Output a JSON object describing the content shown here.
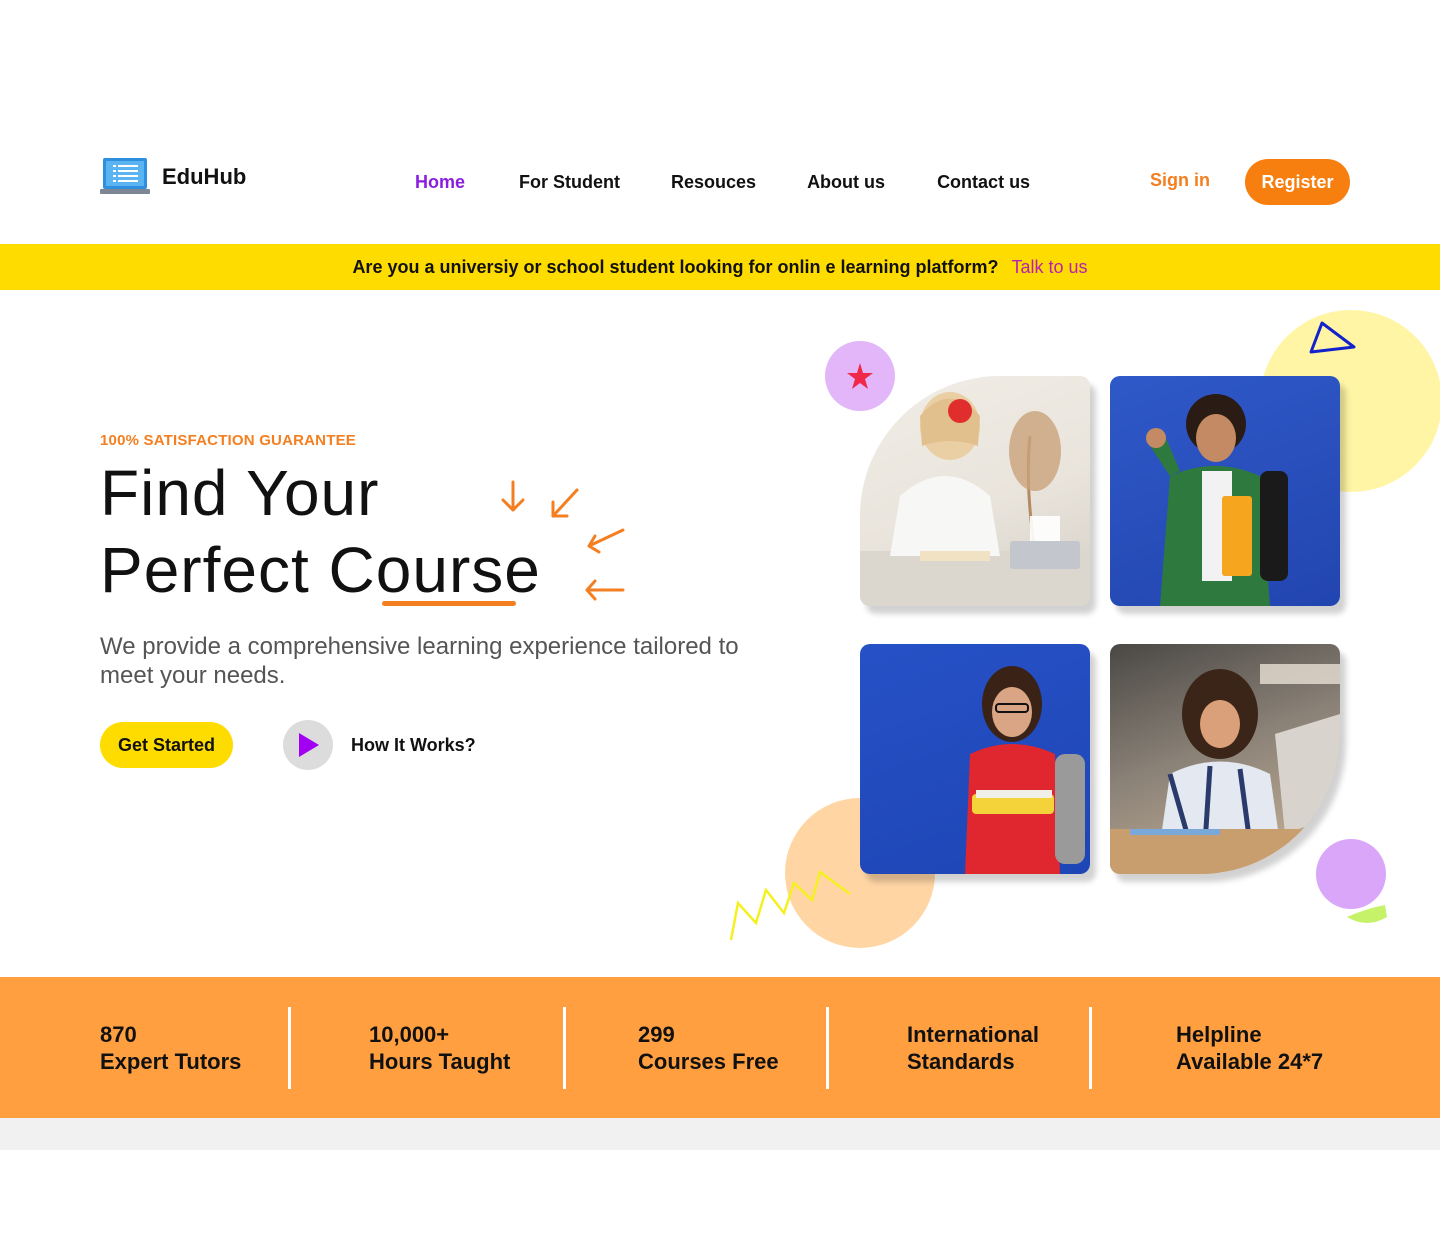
{
  "header": {
    "brand": "EduHub",
    "nav": [
      "Home",
      "For Student",
      "Resouces",
      "About us",
      "Contact us"
    ],
    "active_nav": "Home",
    "sign_in": "Sign in",
    "register": "Register"
  },
  "banner": {
    "question": "Are you a universiy or school student looking for onlin e learning platform?",
    "link": "Talk to us"
  },
  "hero": {
    "eyebrow": "100% SATISFACTION GUARANTEE",
    "headline_line1": "Find Your",
    "headline_line2": "Perfect Course",
    "description": "We provide a comprehensive learning experience tailored to meet your needs.",
    "cta": "Get Started",
    "how_it_works": "How It Works?"
  },
  "stats": [
    {
      "value": "870",
      "label": "Expert Tutors"
    },
    {
      "value": "10,000+",
      "label": "Hours Taught"
    },
    {
      "value": "299",
      "label": "Courses Free"
    },
    {
      "value": "International",
      "label": "Standards"
    },
    {
      "value": "Helpline",
      "label": "Available 24*7"
    }
  ],
  "colors": {
    "accent_orange": "#f77f0f",
    "banner_yellow": "#ffdc00",
    "active_purple": "#8a1ee0",
    "stats_band": "#ff9f40",
    "talk_link": "#b820b0"
  },
  "icons": {
    "logo": "laptop-icon",
    "play": "play-icon",
    "star": "star-icon"
  }
}
